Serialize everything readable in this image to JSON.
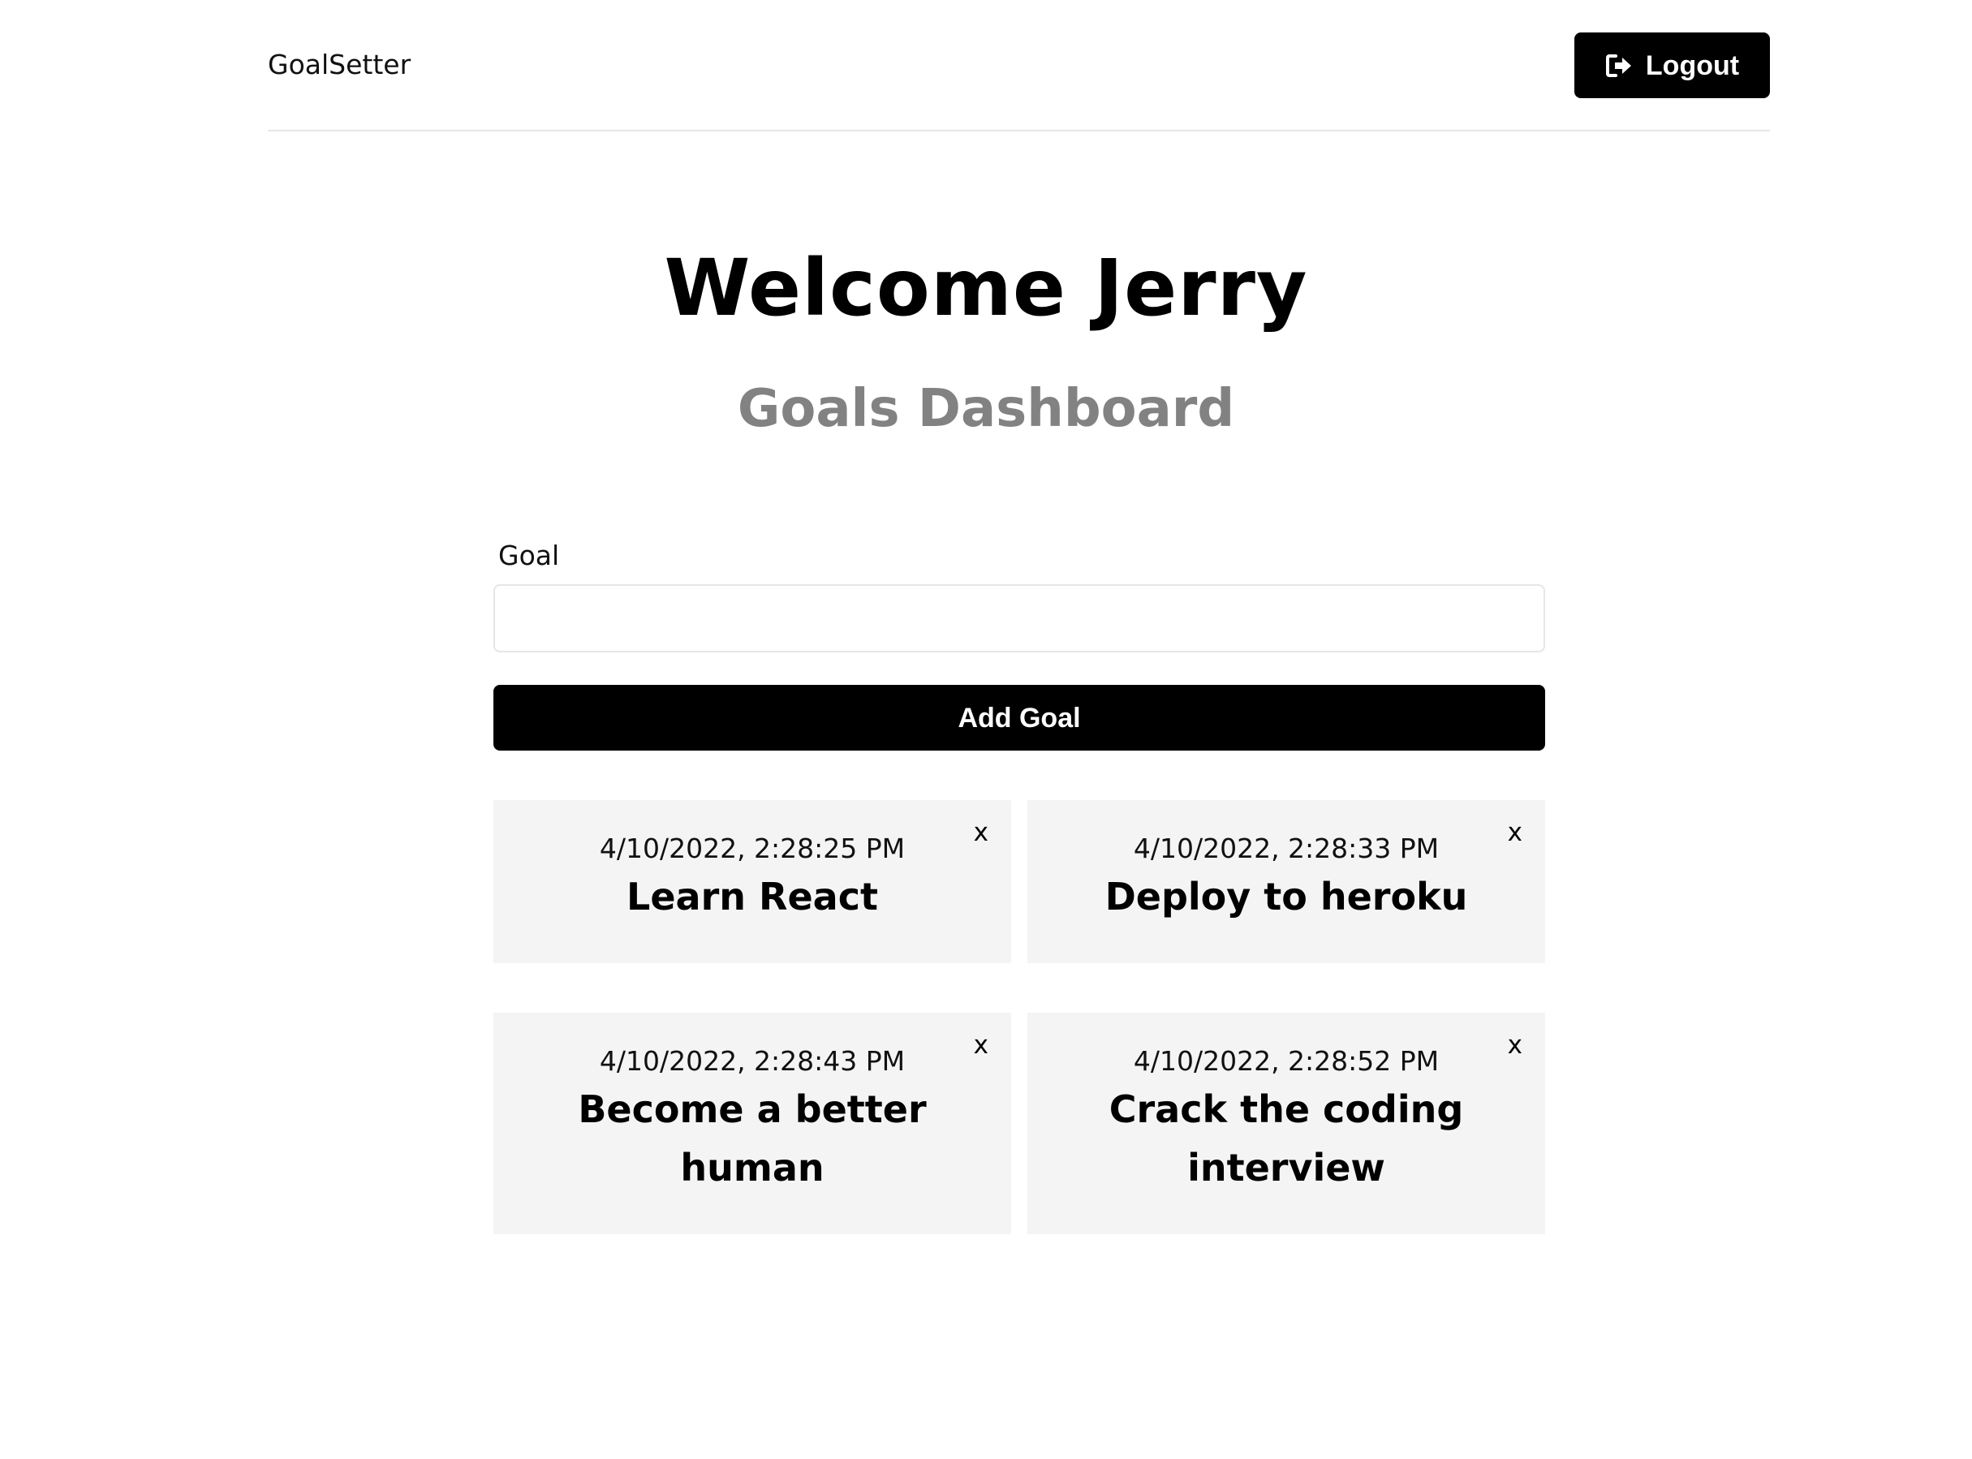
{
  "header": {
    "brand": "GoalSetter",
    "logout_label": "Logout",
    "logout_icon": "sign-out-icon"
  },
  "heading": {
    "welcome": "Welcome Jerry",
    "subtitle": "Goals Dashboard"
  },
  "form": {
    "label": "Goal",
    "value": "",
    "placeholder": "",
    "submit_label": "Add Goal"
  },
  "goals": [
    {
      "date": "4/10/2022, 2:28:25 PM",
      "text": "Learn React",
      "delete_label": "x"
    },
    {
      "date": "4/10/2022, 2:28:33 PM",
      "text": "Deploy to heroku",
      "delete_label": "x"
    },
    {
      "date": "4/10/2022, 2:28:43 PM",
      "text": "Become a better human",
      "delete_label": "x"
    },
    {
      "date": "4/10/2022, 2:28:52 PM",
      "text": "Crack the coding interview",
      "delete_label": "x"
    }
  ],
  "colors": {
    "primary": "#000000",
    "subtitle": "#828282",
    "card_background": "#f4f4f4",
    "divider": "#e6e6e6"
  }
}
